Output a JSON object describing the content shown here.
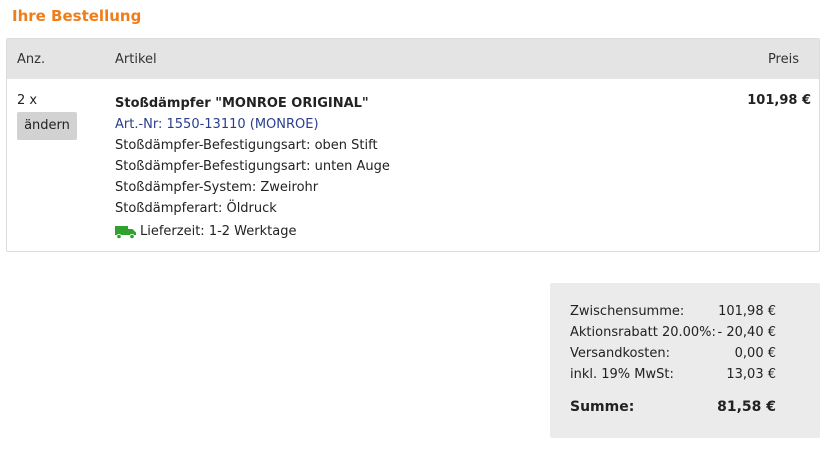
{
  "section_title": "Ihre Bestellung",
  "table": {
    "head": {
      "qty": "Anz.",
      "item": "Artikel",
      "price": "Preis"
    },
    "row": {
      "qty": "2 x",
      "edit_label": "ändern",
      "title": "Stoßdämpfer \"MONROE ORIGINAL\"",
      "art_no": "Art.-Nr: 1550-13110 (MONROE)",
      "attributes": [
        "Stoßdämpfer-Befestigungsart: oben Stift",
        "Stoßdämpfer-Befestigungsart: unten Auge",
        "Stoßdämpfer-System: Zweirohr",
        "Stoßdämpferart: Öldruck"
      ],
      "delivery_icon": "truck-icon",
      "delivery": "Lieferzeit: 1-2 Werktage",
      "price": "101,98 €"
    }
  },
  "summary": {
    "subtotal_label": "Zwischensumme:",
    "subtotal": "101,98 €",
    "discount_label": "Aktionsrabatt 20.00%:",
    "discount": "- 20,40 €",
    "shipping_label": "Versandkosten:",
    "shipping": "0,00 €",
    "vat_label": "inkl. 19% MwSt:",
    "vat": "13,03 €",
    "total_label": "Summe:",
    "total": "81,58 €"
  },
  "colors": {
    "title": "#ef7d1a",
    "link": "#2a3e8c",
    "truck": "#2ea12e",
    "header_bg": "#e4e4e4",
    "summary_bg": "#ebebeb"
  }
}
